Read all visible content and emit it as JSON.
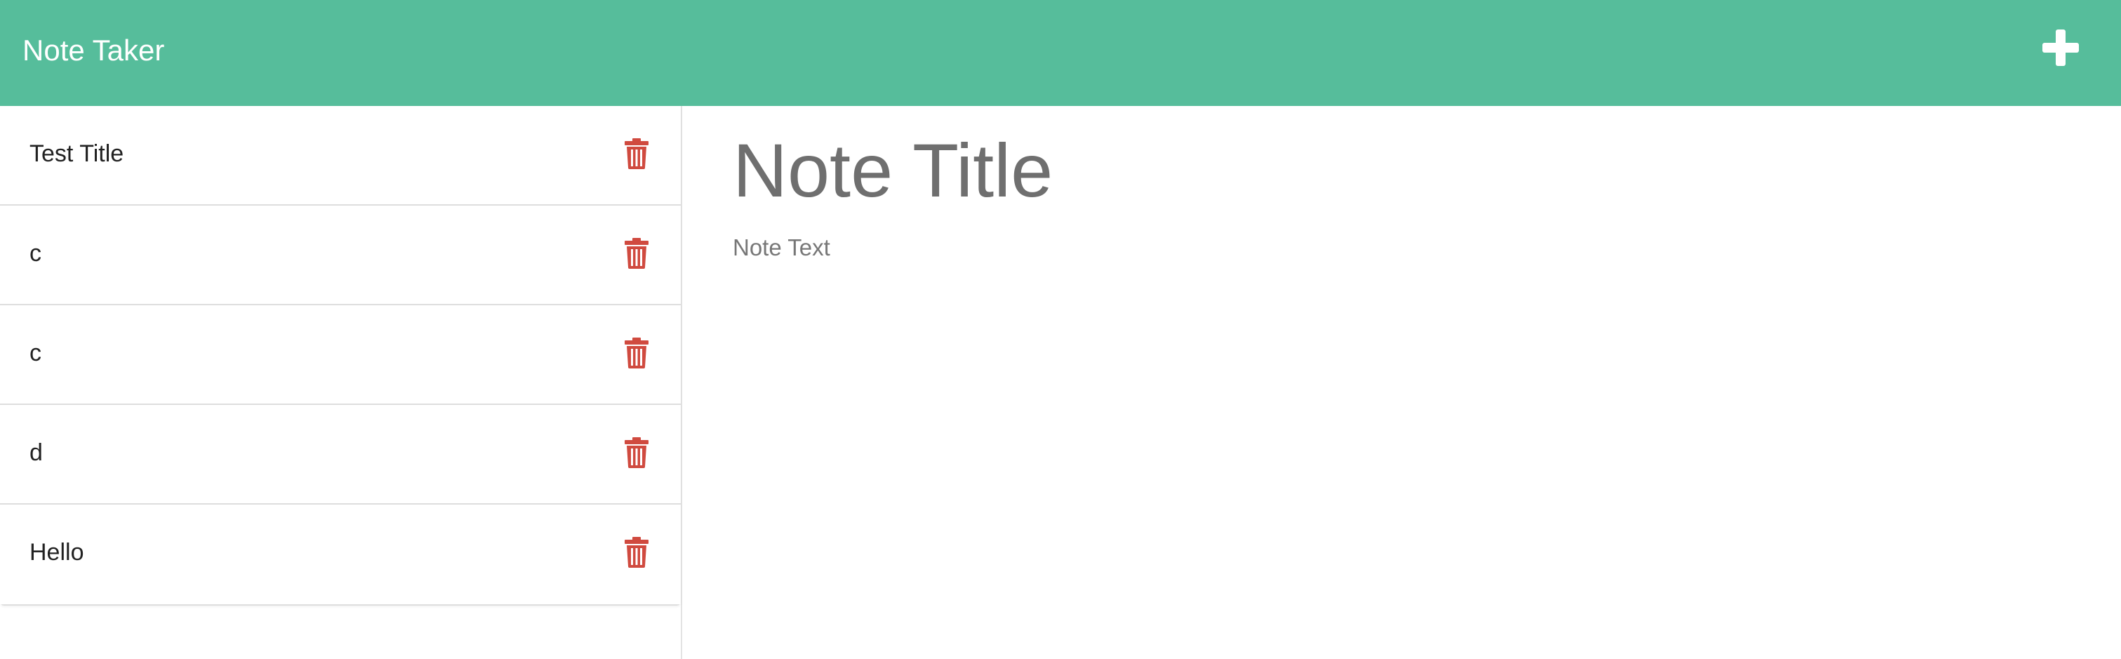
{
  "app": {
    "title": "Note Taker",
    "add_icon": "plus-icon"
  },
  "colors": {
    "header": "#56bd9b",
    "trash": "#d04a3f",
    "placeholder": "#6f6f6f"
  },
  "notes": [
    {
      "title": "Test Title"
    },
    {
      "title": "c"
    },
    {
      "title": "c"
    },
    {
      "title": "d"
    },
    {
      "title": "Hello"
    }
  ],
  "editor": {
    "title_placeholder": "Note Title",
    "text_placeholder": "Note Text"
  }
}
